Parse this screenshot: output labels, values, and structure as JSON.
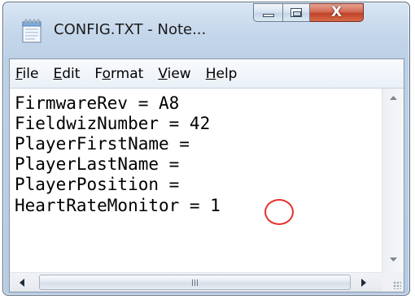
{
  "window": {
    "title": "CONFIG.TXT - Note...",
    "icon": "notepad-icon"
  },
  "caption_buttons": {
    "minimize_icon": "minimize-icon",
    "maximize_icon": "maximize-icon",
    "close_icon": "close-icon",
    "close_glyph": "X"
  },
  "menu": {
    "items": [
      {
        "mnemonic": "F",
        "rest": "ile"
      },
      {
        "mnemonic": "E",
        "rest": "dit"
      },
      {
        "pre": "F",
        "mnemonic": "o",
        "rest": "rmat"
      },
      {
        "mnemonic": "V",
        "rest": "iew"
      },
      {
        "mnemonic": "H",
        "rest": "elp"
      }
    ]
  },
  "document": {
    "lines": [
      "FirmwareRev = A8",
      "FieldwizNumber = 42",
      "PlayerFirstName =",
      "PlayerLastName =",
      "PlayerPosition =",
      "HeartRateMonitor = 1"
    ],
    "annotation_color": "#e4322b"
  },
  "scrollbars": {
    "h_grip_icon": "grip-icon",
    "v_up_icon": "arrow-up-icon",
    "v_down_icon": "arrow-down-icon",
    "h_left_icon": "arrow-left-icon",
    "h_right_icon": "arrow-right-icon",
    "size_grip_icon": "size-grip-icon"
  }
}
